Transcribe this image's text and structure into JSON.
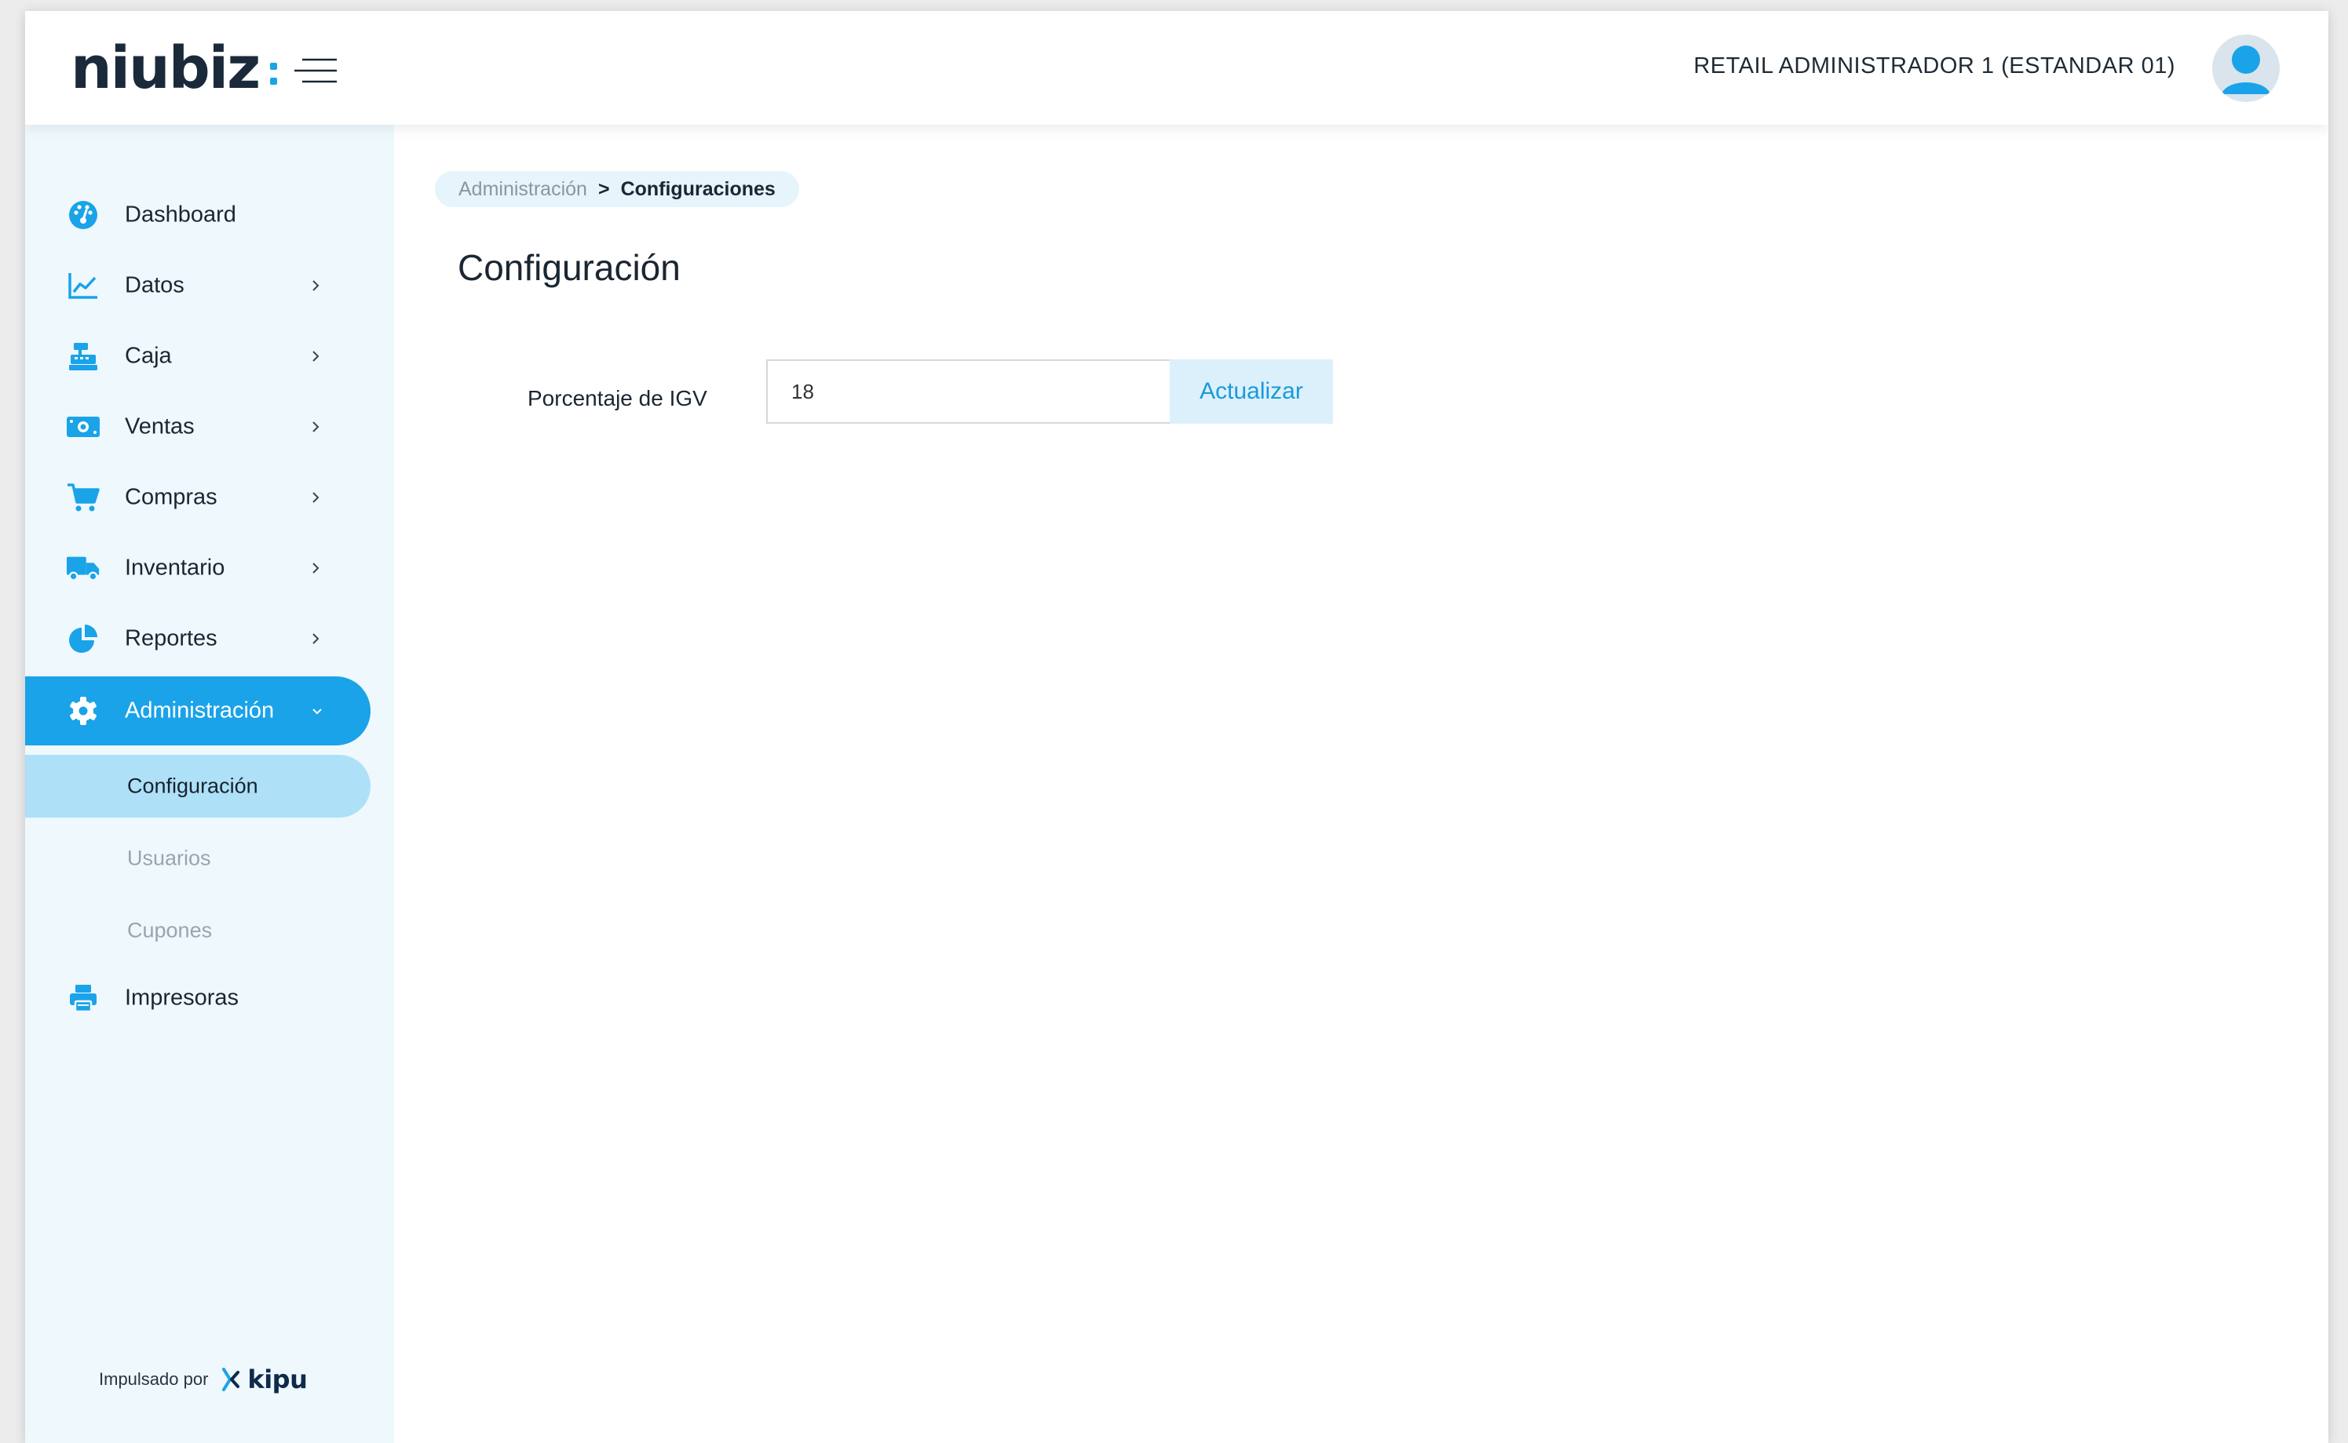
{
  "header": {
    "logo_text": "niubiz",
    "user_name": "RETAIL ADMINISTRADOR 1 (ESTANDAR 01)"
  },
  "sidebar": {
    "items": [
      {
        "label": "Dashboard",
        "icon": "dashboard-icon"
      },
      {
        "label": "Datos",
        "icon": "chart-line-icon"
      },
      {
        "label": "Caja",
        "icon": "cash-register-icon"
      },
      {
        "label": "Ventas",
        "icon": "money-bill-icon"
      },
      {
        "label": "Compras",
        "icon": "shopping-cart-icon"
      },
      {
        "label": "Inventario",
        "icon": "truck-icon"
      },
      {
        "label": "Reportes",
        "icon": "pie-chart-icon"
      },
      {
        "label": "Administración",
        "icon": "gear-icon"
      },
      {
        "label": "Impresoras",
        "icon": "printer-icon"
      }
    ],
    "subitems": [
      {
        "label": "Configuración"
      },
      {
        "label": "Usuarios"
      },
      {
        "label": "Cupones"
      }
    ],
    "footer": {
      "powered_by": "Impulsado por",
      "brand": "kipu"
    }
  },
  "breadcrumb": {
    "parent": "Administración",
    "separator": ">",
    "current": "Configuraciones"
  },
  "main": {
    "title": "Configuración",
    "igv_label": "Porcentaje de IGV",
    "igv_value": "18",
    "update_label": "Actualizar"
  },
  "colors": {
    "accent": "#1aa3e8",
    "sidebar_bg": "#eef8fd",
    "subitem_active_bg": "#aee0f8",
    "text_dark": "#1b2633"
  }
}
